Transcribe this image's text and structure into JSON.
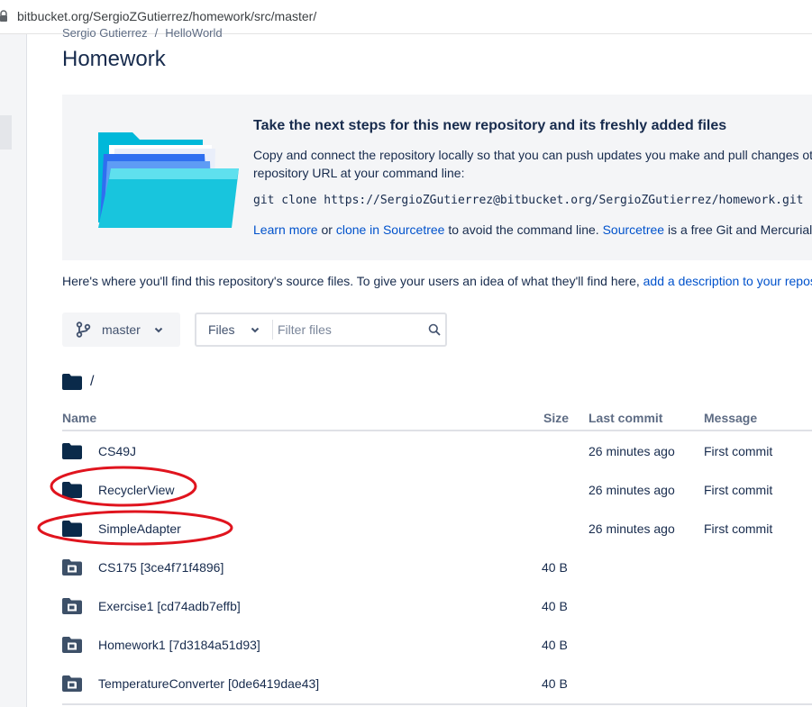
{
  "browser": {
    "url": "bitbucket.org/SergioZGutierrez/homework/src/master/"
  },
  "breadcrumb": {
    "owner": "Sergio Gutierrez",
    "separator": "/",
    "project": "HelloWorld"
  },
  "page": {
    "title": "Homework"
  },
  "banner": {
    "heading": "Take the next steps for this new repository and its freshly added files",
    "desc_line1": "Copy and connect the repository locally so that you can push updates you make and pull changes ot",
    "desc_line2": "repository URL at your command line:",
    "clone_command": "git clone https://SergioZGutierrez@bitbucket.org/SergioZGutierrez/homework.git",
    "learn_more": "Learn more",
    "or_text": " or ",
    "clone_sourcetree": "clone in Sourcetree",
    "avoid_text": " to avoid the command line. ",
    "sourcetree": "Sourcetree",
    "tail_text": " is a free Git and Mercurial c"
  },
  "intro": {
    "text": "Here's where you'll find this repository's source files. To give your users an idea of what they'll find here, ",
    "link": "add a description to your repos"
  },
  "toolbar": {
    "branch": "master",
    "files_dropdown": "Files",
    "filter_placeholder": "Filter files"
  },
  "path": {
    "current": "/"
  },
  "table": {
    "headers": {
      "name": "Name",
      "size": "Size",
      "last_commit": "Last commit",
      "message": "Message"
    },
    "rows": [
      {
        "name": "CS49J",
        "size": "",
        "last_commit": "26 minutes ago",
        "message": "First commit",
        "icon": "folder-icon"
      },
      {
        "name": "RecyclerView",
        "size": "",
        "last_commit": "26 minutes ago",
        "message": "First commit",
        "icon": "folder-icon"
      },
      {
        "name": "SimpleAdapter",
        "size": "",
        "last_commit": "26 minutes ago",
        "message": "First commit",
        "icon": "folder-icon"
      },
      {
        "name": "CS175 [3ce4f71f4896]",
        "size": "40 B",
        "last_commit": "",
        "message": "",
        "icon": "submodule-icon"
      },
      {
        "name": "Exercise1 [cd74adb7effb]",
        "size": "40 B",
        "last_commit": "",
        "message": "",
        "icon": "submodule-icon"
      },
      {
        "name": "Homework1 [7d3184a51d93]",
        "size": "40 B",
        "last_commit": "",
        "message": "",
        "icon": "submodule-icon"
      },
      {
        "name": "TemperatureConverter [0de6419dae43]",
        "size": "40 B",
        "last_commit": "",
        "message": "",
        "icon": "submodule-icon"
      }
    ]
  },
  "colors": {
    "link": "#0052cc",
    "text": "#172b4d",
    "folder": "#0a2a4a",
    "annotation": "#e0141e"
  }
}
